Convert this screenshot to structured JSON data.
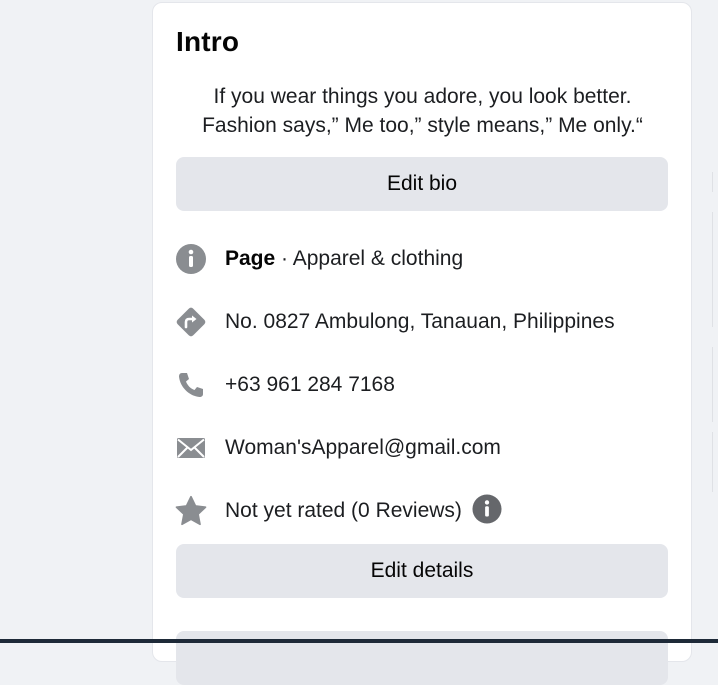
{
  "intro": {
    "title": "Intro",
    "bio_line1": "If you wear things you adore, you look better.",
    "bio_line2": "Fashion says,” Me too,” style means,” Me only.“",
    "edit_bio_label": "Edit bio",
    "edit_details_label": "Edit details"
  },
  "details": {
    "page_type_label": "Page",
    "page_category": " · Apparel & clothing",
    "address": "No. 0827 Ambulong, Tanauan, Philippines",
    "phone": "+63 961 284 7168",
    "email": "Woman'sApparel@gmail.com",
    "rating": "Not yet rated (0 Reviews)"
  },
  "icons": {
    "category": "info-icon",
    "address": "directions-icon",
    "phone": "phone-icon",
    "email": "envelope-icon",
    "rating": "star-icon",
    "rating_info": "info-icon"
  },
  "colors": {
    "icon_gray": "#8a8d91",
    "info_badge_dark": "#65676b",
    "button_bg": "#e4e6eb",
    "card_bg": "#ffffff",
    "page_bg": "#f0f2f5"
  }
}
